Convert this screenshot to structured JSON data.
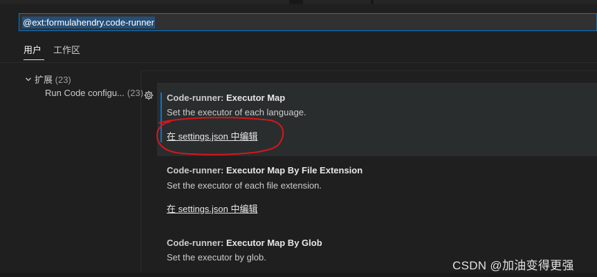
{
  "search": {
    "value": "@ext:formulahendry.code-runner"
  },
  "tabs": [
    {
      "label": "用户"
    },
    {
      "label": "工作区"
    }
  ],
  "toc": {
    "group": {
      "label": "扩展",
      "count": "(23)"
    },
    "items": [
      {
        "label": "Run Code configu...",
        "count": "(23)"
      }
    ]
  },
  "settings": [
    {
      "category": "Code-runner: ",
      "name": "Executor Map",
      "description": "Set the executor of each language.",
      "link": "在 settings.json 中编辑"
    },
    {
      "category": "Code-runner: ",
      "name": "Executor Map By File Extension",
      "description": "Set the executor of each file extension.",
      "link": "在 settings.json 中编辑"
    },
    {
      "category": "Code-runner: ",
      "name": "Executor Map By Glob",
      "description": "Set the executor by glob."
    }
  ],
  "icons": {
    "gear": "gear-icon",
    "chevron": "chevron-down-icon"
  },
  "colors": {
    "accent": "#0078d4",
    "annotation": "#d9161c",
    "background": "#1f1f1f"
  },
  "watermark": "CSDN @加油变得更强"
}
